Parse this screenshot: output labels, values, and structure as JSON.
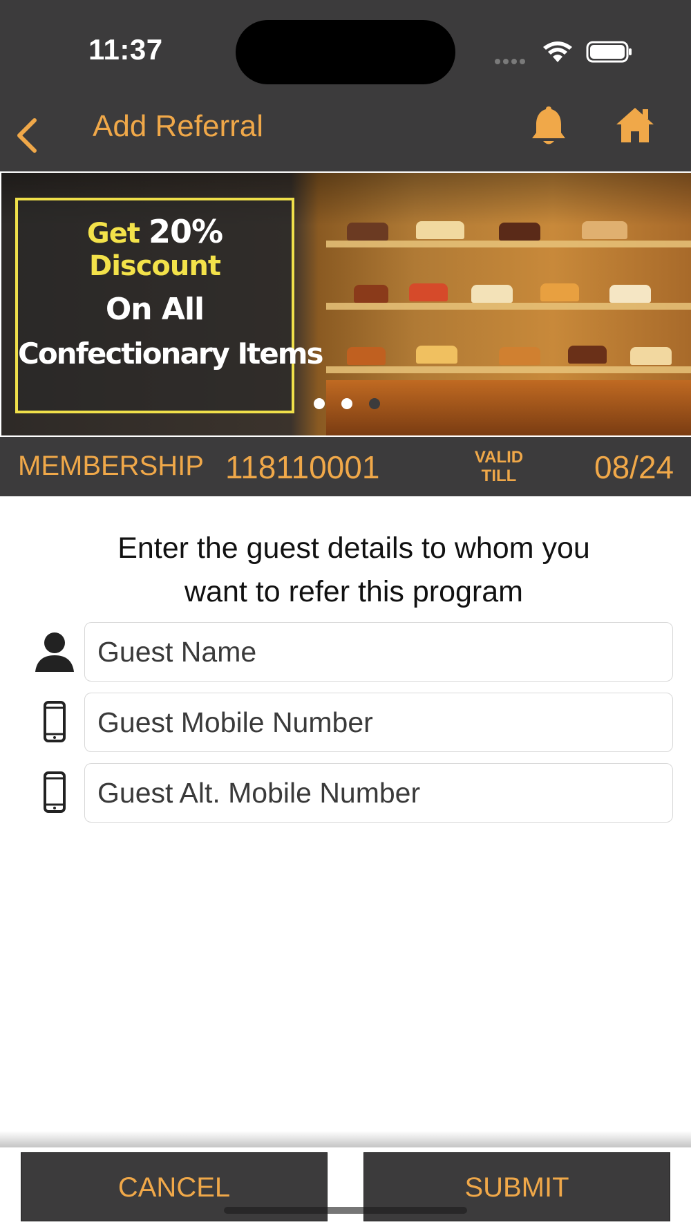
{
  "status_bar": {
    "time": "11:37"
  },
  "nav": {
    "title": "Add Referral"
  },
  "banner": {
    "promo_line1_a": "Get",
    "promo_line1_b": "20%",
    "promo_line1_c": "Discount",
    "promo_line2": "On All",
    "promo_line3": "Confectionary Items",
    "page_count": 3,
    "active_page": 3
  },
  "membership": {
    "label": "MEMBERSHIP",
    "number": "118110001",
    "valid_line1": "VALID",
    "valid_line2": "TILL",
    "valid_date": "08/24"
  },
  "form": {
    "instruction_line1": "Enter the guest details to whom you",
    "instruction_line2": "want to refer this program",
    "guest_name_placeholder": "Guest Name",
    "guest_mobile_placeholder": "Guest Mobile Number",
    "guest_alt_mobile_placeholder": "Guest Alt. Mobile Number"
  },
  "actions": {
    "cancel_label": "CANCEL",
    "submit_label": "SUBMIT"
  },
  "colors": {
    "bar_bg": "#3c3b3c",
    "accent": "#f0a849",
    "promo_yellow": "#f0e04a"
  },
  "icons": [
    "chevron-left-icon",
    "bell-icon",
    "home-icon",
    "person-icon",
    "mobile-phone-icon"
  ]
}
